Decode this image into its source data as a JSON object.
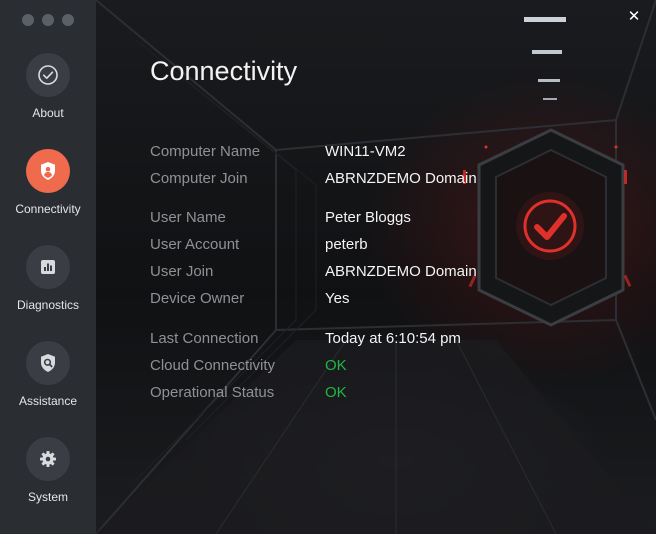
{
  "window": {
    "close_symbol": "✕"
  },
  "sidebar": {
    "items": [
      {
        "label": "About",
        "icon": "check-circle-icon",
        "active": false
      },
      {
        "label": "Connectivity",
        "icon": "shield-user-icon",
        "active": true
      },
      {
        "label": "Diagnostics",
        "icon": "bar-chart-icon",
        "active": false
      },
      {
        "label": "Assistance",
        "icon": "shield-search-icon",
        "active": false
      },
      {
        "label": "System",
        "icon": "gear-icon",
        "active": false
      }
    ]
  },
  "main": {
    "title": "Connectivity",
    "computer": {
      "name_label": "Computer Name",
      "name_value": "WIN11-VM2",
      "join_label": "Computer Join",
      "join_value": "ABRNZDEMO Domain"
    },
    "user": {
      "name_label": "User Name",
      "name_value": "Peter Bloggs",
      "account_label": "User Account",
      "account_value": "peterb",
      "join_label": "User Join",
      "join_value": "ABRNZDEMO Domain",
      "owner_label": "Device Owner",
      "owner_value": "Yes"
    },
    "status": {
      "last_label": "Last Connection",
      "last_value": "Today at 6:10:54 pm",
      "cloud_label": "Cloud Connectivity",
      "cloud_value": "OK",
      "op_label": "Operational Status",
      "op_value": "OK"
    }
  },
  "colors": {
    "accent": "#f06a4d",
    "ok": "#1fb844",
    "sidebar": "#2a2d32",
    "label": "#8e9196",
    "value": "#f4f4f4",
    "check_red": "#e0302a"
  }
}
